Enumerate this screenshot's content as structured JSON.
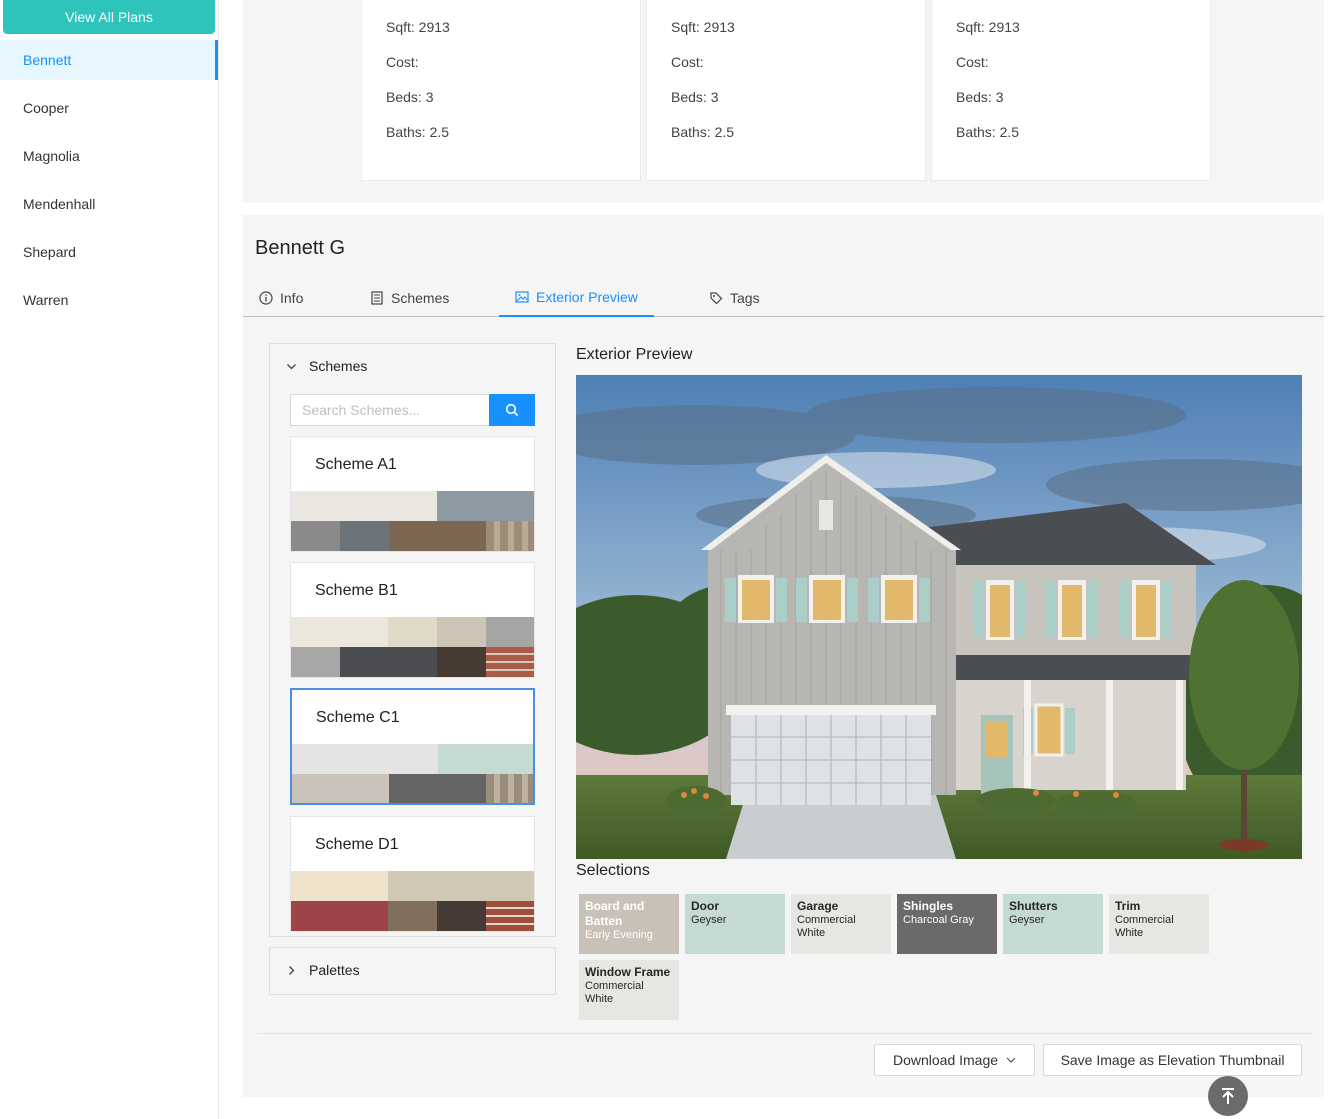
{
  "sidebar": {
    "view_all_label": "View All Plans",
    "items": [
      {
        "label": "Bennett",
        "active": true
      },
      {
        "label": "Cooper"
      },
      {
        "label": "Magnolia"
      },
      {
        "label": "Mendenhall"
      },
      {
        "label": "Shepard"
      },
      {
        "label": "Warren"
      }
    ]
  },
  "cards": [
    {
      "sqft": "Sqft: 2913",
      "cost": "Cost:",
      "beds": "Beds: 3",
      "baths": "Baths: 2.5"
    },
    {
      "sqft": "Sqft: 2913",
      "cost": "Cost:",
      "beds": "Beds: 3",
      "baths": "Baths: 2.5"
    },
    {
      "sqft": "Sqft: 2913",
      "cost": "Cost:",
      "beds": "Beds: 3",
      "baths": "Baths: 2.5"
    }
  ],
  "plan": {
    "title": "Bennett G"
  },
  "tabs": [
    {
      "label": "Info",
      "icon": "info-icon"
    },
    {
      "label": "Schemes",
      "icon": "schemes-icon"
    },
    {
      "label": "Exterior Preview",
      "icon": "image-icon",
      "active": true
    },
    {
      "label": "Tags",
      "icon": "tag-icon"
    }
  ],
  "schemes_panel": {
    "header": "Schemes",
    "search_placeholder": "Search Schemes...",
    "schemes": [
      {
        "name": "Scheme A1"
      },
      {
        "name": "Scheme B1"
      },
      {
        "name": "Scheme C1",
        "selected": true
      },
      {
        "name": "Scheme D1"
      }
    ]
  },
  "palettes_header": "Palettes",
  "preview": {
    "title": "Exterior Preview"
  },
  "selections": {
    "title": "Selections",
    "items": [
      {
        "category": "Board and Batten",
        "value": "Early Evening",
        "color": "#c9c0b7"
      },
      {
        "category": "Door",
        "value": "Geyser",
        "color": "#c6dad4"
      },
      {
        "category": "Garage",
        "value": "Commercial White",
        "color": "#e6e6e2"
      },
      {
        "category": "Shingles",
        "value": "Charcoal Gray",
        "color": "#6b6a68"
      },
      {
        "category": "Shutters",
        "value": "Geyser",
        "color": "#c6dad4"
      },
      {
        "category": "Trim",
        "value": "Commercial White",
        "color": "#e6e6e2"
      },
      {
        "category": "Window Frame",
        "value": "Commercial White",
        "color": "#e6e6e2"
      }
    ]
  },
  "actions": {
    "download_label": "Download Image",
    "save_thumbnail_label": "Save Image as Elevation Thumbnail"
  },
  "colors": {
    "accent": "#1890ff",
    "brand_button": "#2ec4bc"
  }
}
